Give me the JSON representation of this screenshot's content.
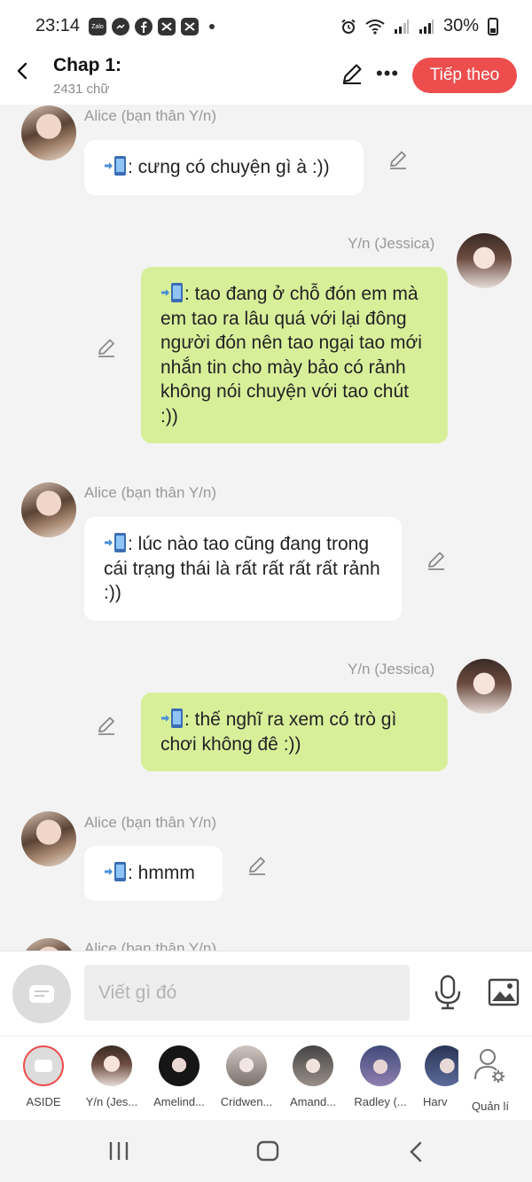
{
  "status_bar": {
    "time": "23:14",
    "app_icons": [
      "zalo-icon",
      "messenger-icon",
      "facebook-icon",
      "capcut-icon",
      "capcut-icon"
    ],
    "zalo_label": "Zalo",
    "battery": "30%"
  },
  "header": {
    "title": "Chap 1:",
    "subtitle": "2431 chữ",
    "next_label": "Tiếp theo"
  },
  "messages": [
    {
      "sender": "Alice (bạn thân Y/n)",
      "side": "left",
      "text": ": cưng có chuyện gì à :))"
    },
    {
      "sender": "Y/n (Jessica)",
      "side": "right",
      "text": ": tao đang ở chỗ đón em mà em tao ra lâu quá với lại đông người đón nên tao ngại tao mới nhắn tin cho mày bảo có rảnh không nói chuyện với tao chút :))"
    },
    {
      "sender": "Alice (bạn thân Y/n)",
      "side": "left",
      "text": ": lúc nào tao cũng đang trong cái trạng thái là rất rất rất rất rảnh :))"
    },
    {
      "sender": "Y/n (Jessica)",
      "side": "right",
      "text": ": thế nghĩ ra xem có trò gì chơi không đê :))"
    },
    {
      "sender": "Alice (bạn thân Y/n)",
      "side": "left",
      "text": ": hmmm"
    },
    {
      "sender": "Alice (bạn thân Y/n)",
      "side": "left",
      "text": ""
    }
  ],
  "composer": {
    "placeholder": "Viết gì đó"
  },
  "characters": [
    {
      "label": "ASIDE"
    },
    {
      "label": "Y/n (Jes..."
    },
    {
      "label": "Amelind..."
    },
    {
      "label": "Cridwen..."
    },
    {
      "label": "Amand..."
    },
    {
      "label": "Radley (..."
    },
    {
      "label": "Harv"
    },
    {
      "label": "Quản lí"
    }
  ],
  "colors": {
    "accent": "#ee4d4d",
    "bubble_right": "#d8ef9a",
    "bubble_left": "#ffffff",
    "chat_background": "#f3f3f3"
  }
}
